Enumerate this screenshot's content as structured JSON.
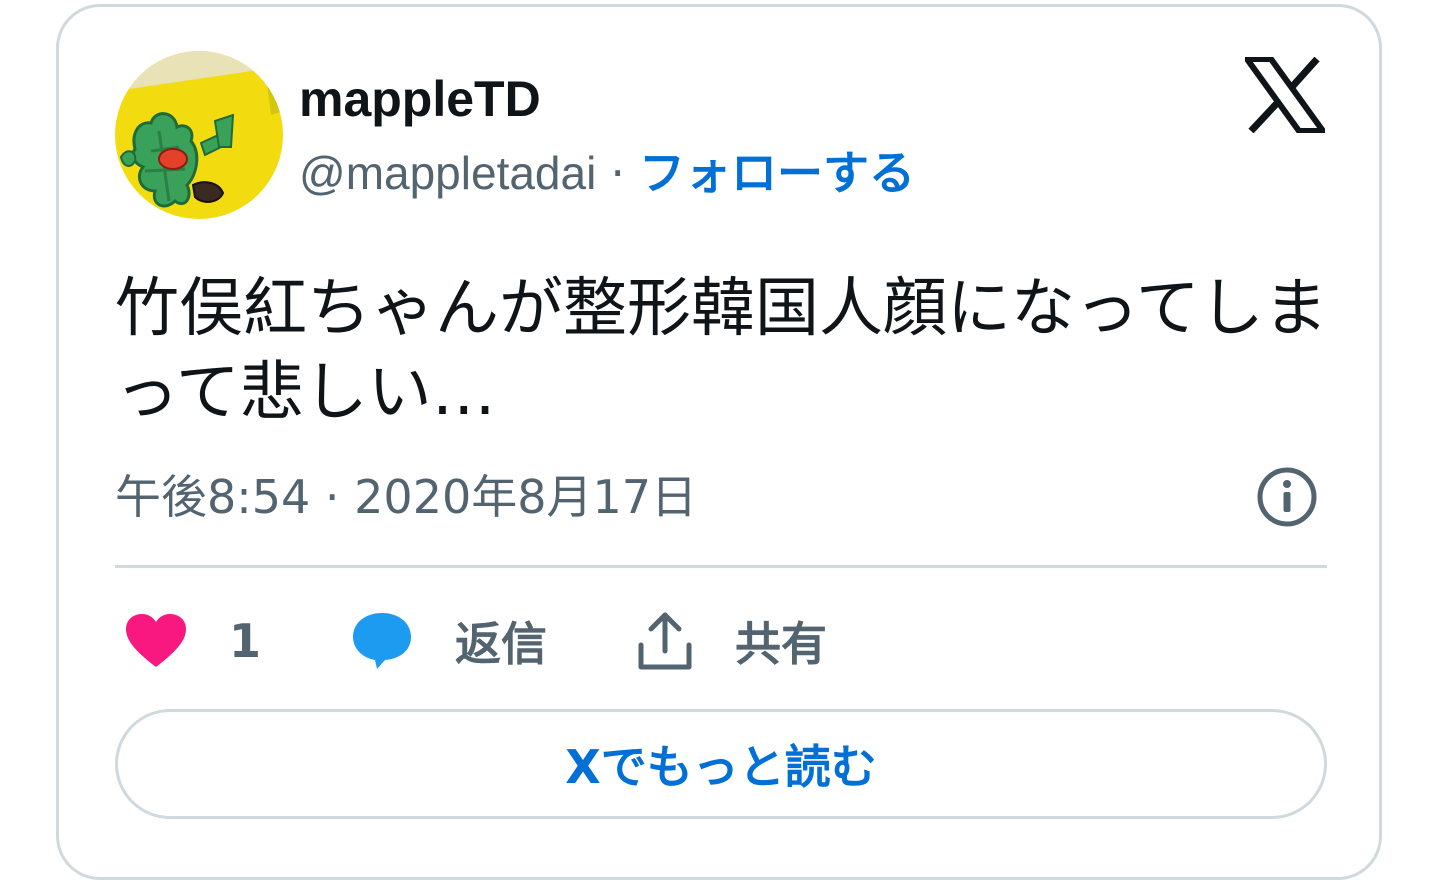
{
  "tweet": {
    "author": {
      "display_name": "mappleTD",
      "handle": "@mappletadai",
      "avatar": "child-drawing-avatar"
    },
    "follow_label": "フォローする",
    "separator": "·",
    "text": "竹俣紅ちゃんが整形韓国人顔になってしまって悲しい…",
    "timestamp": "午後8:54 · 2020年8月17日",
    "likes_count": "1",
    "reply_label": "返信",
    "share_label": "共有",
    "read_more_label": "Xでもっと読む"
  },
  "icons": {
    "brand": "x-logo-icon",
    "info": "info-icon",
    "like": "heart-icon",
    "reply": "speech-bubble-icon",
    "share": "share-upload-icon"
  },
  "colors": {
    "text_primary": "#0f1419",
    "text_secondary": "#536471",
    "link": "#006fd6",
    "like": "#f91880",
    "reply_bubble": "#1d9bf0",
    "border": "#cfd9de"
  }
}
